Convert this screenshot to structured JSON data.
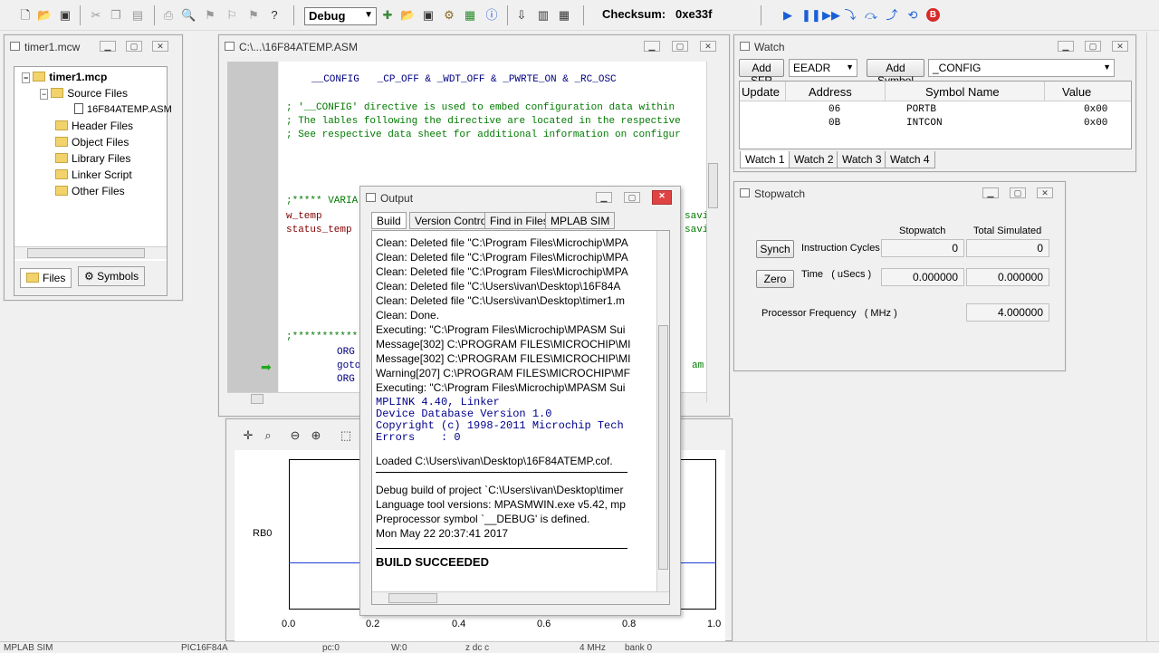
{
  "toolbar": {
    "config_value": "Debug",
    "checksum_label": "Checksum:",
    "checksum_value": "0xe33f"
  },
  "project_window": {
    "title": "timer1.mcw",
    "root": "timer1.mcp",
    "items": [
      {
        "label": "Source Files"
      },
      {
        "label": "16F84ATEMP.ASM"
      },
      {
        "label": "Header Files"
      },
      {
        "label": "Object Files"
      },
      {
        "label": "Library Files"
      },
      {
        "label": "Linker Script"
      },
      {
        "label": "Other Files"
      }
    ],
    "tabs": [
      "Files",
      "Symbols"
    ]
  },
  "editor_window": {
    "title": "C:\\...\\16F84ATEMP.ASM",
    "lines": [
      "__CONFIG   _CP_OFF & _WDT_OFF & _PWRTE_ON & _RC_OSC",
      "; '__CONFIG' directive is used to embed configuration data within",
      "; The lables following the directive are located in the respective",
      "; See respective data sheet for additional information on configur",
      ";***** VARIA",
      "w_temp",
      "status_temp",
      ";***********",
      "ORG",
      "goto",
      "ORG"
    ],
    "right_fragments": [
      "savi",
      "savi",
      "am"
    ]
  },
  "watch_window": {
    "title": "Watch",
    "add_sfr": "Add SFR",
    "sfr_value": "EEADR",
    "add_symbol": "Add Symbol",
    "symbol_value": "_CONFIG",
    "columns": [
      "Update",
      "Address",
      "Symbol Name",
      "Value"
    ],
    "rows": [
      {
        "address": "06",
        "symbol": "PORTB",
        "value": "0x00"
      },
      {
        "address": "0B",
        "symbol": "INTCON",
        "value": "0x00"
      }
    ],
    "tabs": [
      "Watch 1",
      "Watch 2",
      "Watch 3",
      "Watch 4"
    ]
  },
  "stopwatch_window": {
    "title": "Stopwatch",
    "col_stopwatch": "Stopwatch",
    "col_total": "Total Simulated",
    "synch": "Synch",
    "zero": "Zero",
    "instr_label": "Instruction Cycles",
    "instr_stopwatch": "0",
    "instr_total": "0",
    "time_label": "Time   ( uSecs )",
    "time_stopwatch": "0.000000",
    "time_total": "0.000000",
    "freq_label": "Processor Frequency   ( MHz )",
    "freq_value": "4.000000"
  },
  "output_window": {
    "title": "Output",
    "tabs": [
      "Build",
      "Version Control",
      "Find in Files",
      "MPLAB SIM"
    ],
    "lines_sans": [
      "Clean: Deleted file \"C:\\Program Files\\Microchip\\MPA",
      "Clean: Deleted file \"C:\\Program Files\\Microchip\\MPA",
      "Clean: Deleted file \"C:\\Program Files\\Microchip\\MPA",
      "Clean: Deleted file \"C:\\Users\\ivan\\Desktop\\16F84A",
      "Clean: Deleted file \"C:\\Users\\ivan\\Desktop\\timer1.m",
      "Clean: Done.",
      "Executing: \"C:\\Program Files\\Microchip\\MPASM Sui",
      "Message[302] C:\\PROGRAM FILES\\MICROCHIP\\MI",
      "Message[302] C:\\PROGRAM FILES\\MICROCHIP\\MI",
      "Warning[207] C:\\PROGRAM FILES\\MICROCHIP\\MF",
      "Executing: \"C:\\Program Files\\Microchip\\MPASM Sui"
    ],
    "lines_mono": [
      "MPLINK 4.40, Linker",
      "Device Database Version 1.0",
      "Copyright (c) 1998-2011 Microchip Tech",
      "Errors    : 0"
    ],
    "loaded": "Loaded C:\\Users\\ivan\\Desktop\\16F84ATEMP.cof.",
    "debug_lines": [
      "Debug build of project `C:\\Users\\ivan\\Desktop\\timer",
      "Language tool versions: MPASMWIN.exe v5.42, mp",
      "Preprocessor symbol `__DEBUG' is defined.",
      "Mon May 22 20:37:41 2017"
    ],
    "result": "BUILD SUCCEEDED"
  },
  "logic_analyzer": {
    "channel": "RB0",
    "x_ticks": [
      "0.0",
      "0.2",
      "0.4",
      "0.6",
      "0.8",
      "1.0"
    ]
  },
  "statusbar": {
    "items": [
      "MPLAB SIM",
      "PIC16F84A",
      "pc:0",
      "W:0",
      "z dc c",
      "4 MHz",
      "bank 0"
    ]
  }
}
